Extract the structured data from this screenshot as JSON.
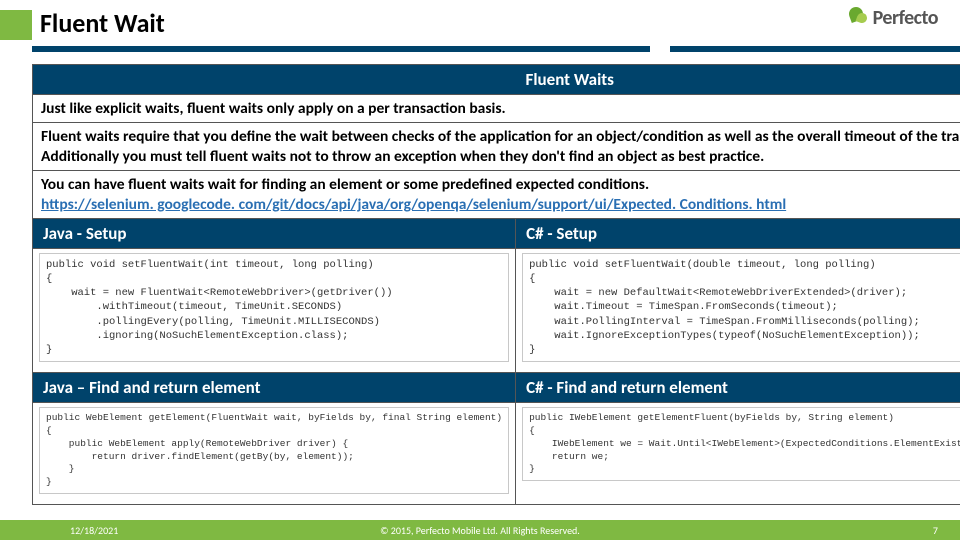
{
  "header": {
    "title": "Fluent Wait",
    "logo_text": "Perfecto"
  },
  "table": {
    "section_title": "Fluent Waits",
    "row1": "Just like explicit waits, fluent waits only apply on a per transaction basis.",
    "row2": "Fluent waits require that you define the wait between checks of the application for an object/condition as well as the overall timeout of the transaction.  Additionally you must tell fluent waits not to throw an exception when they don't find an object as best practice.",
    "row3_text": "You can have fluent waits wait for finding an element or some predefined expected conditions.",
    "row3_link": "https://selenium. googlecode. com/git/docs/api/java/org/openqa/selenium/support/ui/Expected. Conditions. html",
    "col_java_setup": "Java - Setup",
    "col_cs_setup": "C# - Setup",
    "col_java_find": "Java – Find and return element",
    "col_cs_find": "C# - Find and return element",
    "code": {
      "java_setup": "public void setFluentWait(int timeout, long polling)\n{\n    wait = new FluentWait<RemoteWebDriver>(getDriver())\n        .withTimeout(timeout, TimeUnit.SECONDS)\n        .pollingEvery(polling, TimeUnit.MILLISECONDS)\n        .ignoring(NoSuchElementException.class);\n}",
      "cs_setup": "public void setFluentWait(double timeout, long polling)\n{\n    wait = new DefaultWait<RemoteWebDriverExtended>(driver);\n    wait.Timeout = TimeSpan.FromSeconds(timeout);\n    wait.PollingInterval = TimeSpan.FromMilliseconds(polling);\n    wait.IgnoreExceptionTypes(typeof(NoSuchElementException));\n}",
      "java_find": "public WebElement getElement(FluentWait wait, byFields by, final String element)\n{\n    public WebElement apply(RemoteWebDriver driver) {\n        return driver.findElement(getBy(by, element));\n    }\n}",
      "cs_find": "public IWebElement getElementFluent(byFields by, String element)\n{\n    IWebElement we = Wait.Until<IWebElement>(ExpectedConditions.ElementExists(getBy(by, element)));\n    return we;\n}"
    }
  },
  "footer": {
    "date": "12/18/2021",
    "copyright": "© 2015, Perfecto Mobile Ltd.  All Rights Reserved.",
    "page": "7"
  }
}
